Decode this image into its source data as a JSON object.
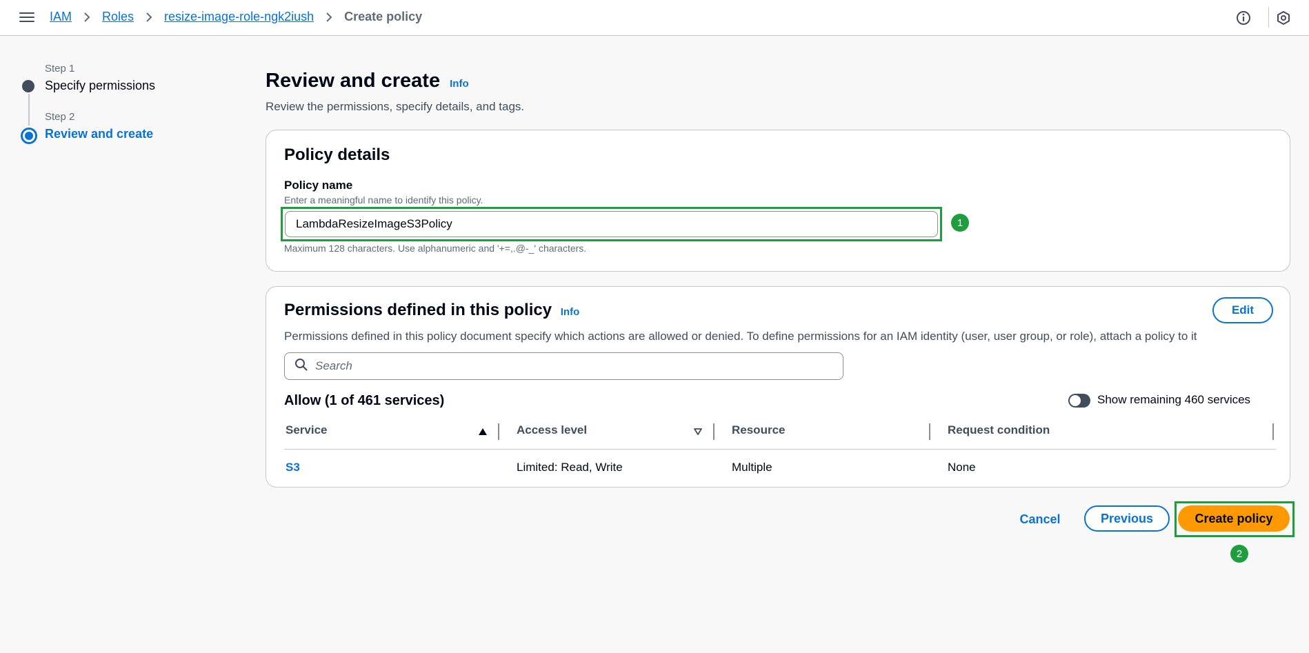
{
  "topbar": {
    "breadcrumbs": [
      {
        "label": "IAM"
      },
      {
        "label": "Roles"
      },
      {
        "label": "resize-image-role-ngk2iush"
      }
    ],
    "current": "Create policy"
  },
  "steps": [
    {
      "label": "Step 1",
      "title": "Specify permissions",
      "state": "complete"
    },
    {
      "label": "Step 2",
      "title": "Review and create",
      "state": "active"
    }
  ],
  "main": {
    "title": "Review and create",
    "info": "Info",
    "description": "Review the permissions, specify details, and tags."
  },
  "policy_details": {
    "heading": "Policy details",
    "name_label": "Policy name",
    "name_description": "Enter a meaningful name to identify this policy.",
    "name_value": "LambdaResizeImageS3Policy",
    "name_constraint": "Maximum 128 characters. Use alphanumeric and '+=,.@-_' characters."
  },
  "permissions": {
    "heading": "Permissions defined in this policy",
    "info": "Info",
    "edit_label": "Edit",
    "description": "Permissions defined in this policy document specify which actions are allowed or denied. To define permissions for an IAM identity (user, user group, or role), attach a policy to it",
    "search_placeholder": "Search",
    "allow_heading": "Allow (1 of 461 services)",
    "toggle_label": "Show remaining 460 services",
    "columns": [
      "Service",
      "Access level",
      "Resource",
      "Request condition"
    ],
    "rows": [
      {
        "service": "S3",
        "access_level": "Limited: Read, Write",
        "resource": "Multiple",
        "request_condition": "None"
      }
    ]
  },
  "footer": {
    "cancel_label": "Cancel",
    "previous_label": "Previous",
    "create_label": "Create policy"
  },
  "annotations": {
    "marker_1": "1",
    "marker_2": "2"
  },
  "colors": {
    "link": "#0972d3",
    "primary_button": "#ff9900",
    "highlight": "#1d9e3c",
    "text": "#000716"
  }
}
